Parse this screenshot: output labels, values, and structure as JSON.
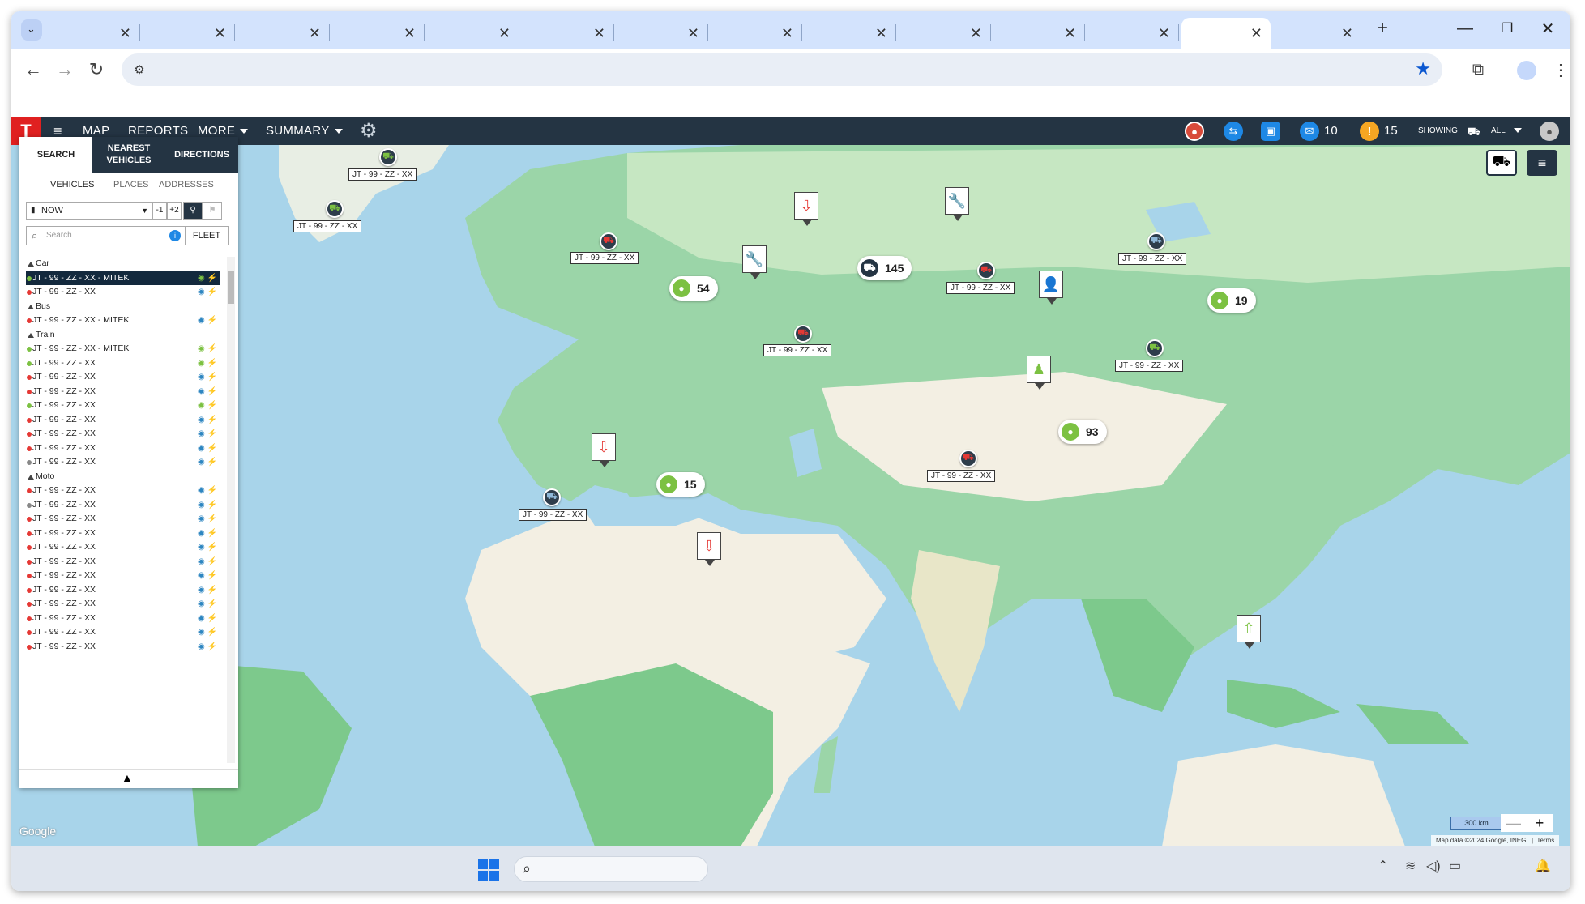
{
  "browser": {
    "tab_close_glyph": "✕",
    "new_tab_glyph": "+",
    "window_controls": {
      "minimize": "—",
      "restore": "❐",
      "close": "✕"
    }
  },
  "app": {
    "logo_text": "T",
    "menu": {
      "map": "MAP",
      "reports": "REPORTS",
      "more": "MORE",
      "summary": "SUMMARY"
    },
    "messages_count": "10",
    "alerts_count": "15",
    "showing_label": "SHOWING",
    "showing_value": "ALL"
  },
  "panel": {
    "tabs": {
      "search": "SEARCH",
      "nearest": "NEAREST VEHICLES",
      "directions": "DIRECTIONS"
    },
    "subtabs": {
      "vehicles": "VEHICLES",
      "places": "PLACES",
      "addresses": "ADDRESSES"
    },
    "time_select": "NOW",
    "minus_one": "-1",
    "plus_two": "+2",
    "search_placeholder": "Search",
    "fleet_button": "FLEET",
    "list": [
      {
        "type": "group",
        "label": "Car"
      },
      {
        "type": "item",
        "label": "JT - 99 - ZZ - XX - MITEK",
        "dot": "#7cc142",
        "selected": true
      },
      {
        "type": "item",
        "label": "JT - 99 - ZZ - XX",
        "dot": "#e53935"
      },
      {
        "type": "group",
        "label": "Bus"
      },
      {
        "type": "item",
        "label": "JT - 99 - ZZ - XX - MITEK",
        "dot": "#e53935"
      },
      {
        "type": "group",
        "label": "Train"
      },
      {
        "type": "item",
        "label": "JT - 99 - ZZ - XX - MITEK",
        "dot": "#7cc142"
      },
      {
        "type": "item",
        "label": "JT - 99 - ZZ - XX",
        "dot": "#7cc142"
      },
      {
        "type": "item",
        "label": "JT - 99 - ZZ - XX",
        "dot": "#e53935"
      },
      {
        "type": "item",
        "label": "JT - 99 - ZZ - XX",
        "dot": "#e53935"
      },
      {
        "type": "item",
        "label": "JT - 99 - ZZ - XX",
        "dot": "#7cc142"
      },
      {
        "type": "item",
        "label": "JT - 99 - ZZ - XX",
        "dot": "#e53935"
      },
      {
        "type": "item",
        "label": "JT - 99 - ZZ - XX",
        "dot": "#e53935"
      },
      {
        "type": "item",
        "label": "JT - 99 - ZZ - XX",
        "dot": "#e53935"
      },
      {
        "type": "item",
        "label": "JT - 99 - ZZ - XX",
        "dot": "#888888"
      },
      {
        "type": "group",
        "label": "Moto"
      },
      {
        "type": "item",
        "label": "JT - 99 - ZZ - XX",
        "dot": "#e53935"
      },
      {
        "type": "item",
        "label": "JT - 99 - ZZ - XX",
        "dot": "#888888"
      },
      {
        "type": "item",
        "label": "JT - 99 - ZZ - XX",
        "dot": "#e53935"
      },
      {
        "type": "item",
        "label": "JT - 99 - ZZ - XX",
        "dot": "#e53935"
      },
      {
        "type": "item",
        "label": "JT - 99 - ZZ - XX",
        "dot": "#e53935"
      },
      {
        "type": "item",
        "label": "JT - 99 - ZZ - XX",
        "dot": "#e53935"
      },
      {
        "type": "item",
        "label": "JT - 99 - ZZ - XX",
        "dot": "#e53935"
      },
      {
        "type": "item",
        "label": "JT - 99 - ZZ - XX",
        "dot": "#e53935"
      },
      {
        "type": "item",
        "label": "JT - 99 - ZZ - XX",
        "dot": "#e53935"
      },
      {
        "type": "item",
        "label": "JT - 99 - ZZ - XX",
        "dot": "#e53935"
      },
      {
        "type": "item",
        "label": "JT - 99 - ZZ - XX",
        "dot": "#e53935"
      },
      {
        "type": "item",
        "label": "JT - 99 - ZZ - XX",
        "dot": "#e53935"
      }
    ]
  },
  "map": {
    "plates": [
      "JT - 99 - ZZ - XX",
      "JT - 99 - ZZ - XX",
      "JT - 99 - ZZ - XX",
      "JT - 99 - ZZ - XX",
      "JT - 99 - ZZ - XX",
      "JT - 99 - ZZ - XX",
      "JT - 99 - ZZ - XX",
      "JT - 99 - ZZ - XX",
      "JT - 99 - ZZ - XX",
      "JT - 99 - ZZ - XX"
    ],
    "clusters": {
      "c54": "54",
      "c145": "145",
      "c19": "19",
      "c93": "93",
      "c15": "15"
    },
    "scale": "300 km",
    "google": "Google",
    "attribution": "Map data ©2024 Google, INEGI",
    "terms": "Terms"
  },
  "colors": {
    "header": "#243443",
    "brand": "#e02020",
    "ok": "#7cc142",
    "alert": "#e53935",
    "water": "#a8d4ea"
  }
}
